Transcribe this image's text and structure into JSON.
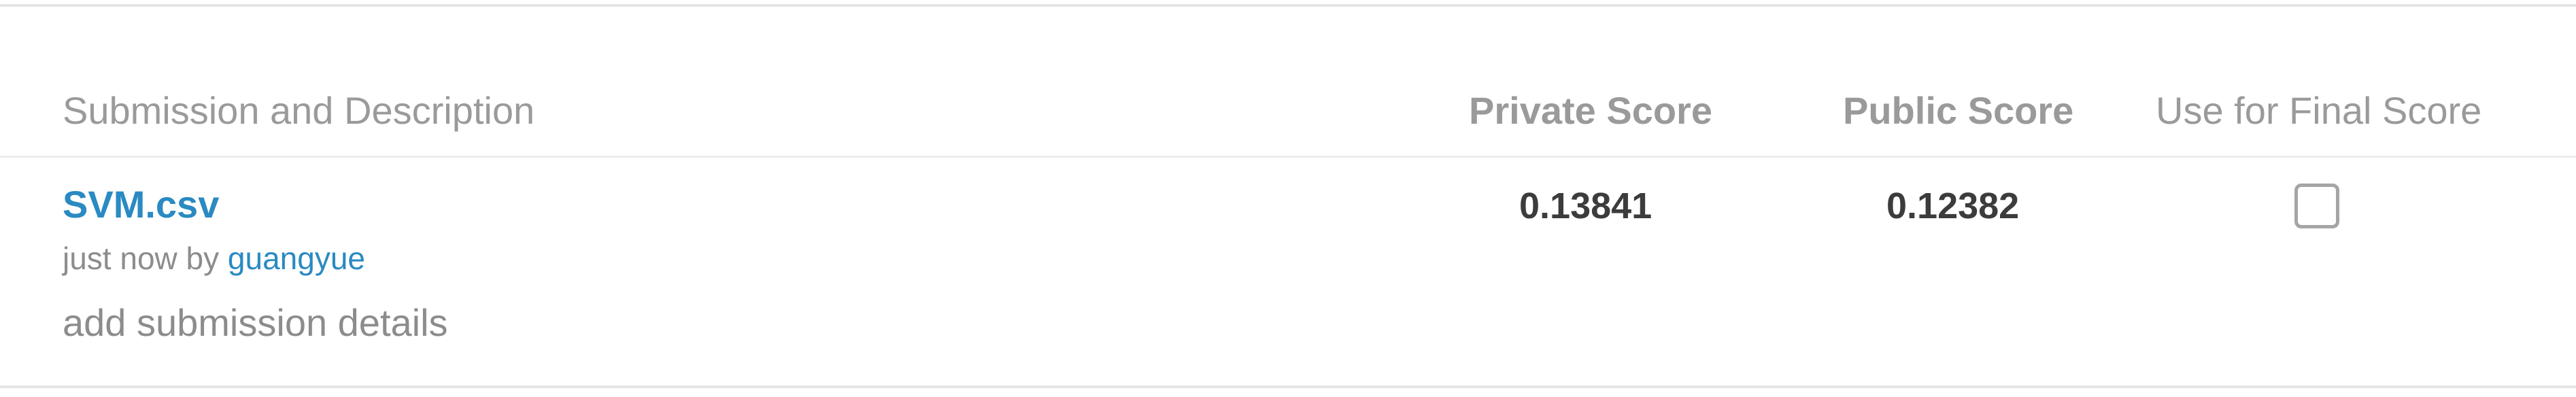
{
  "table": {
    "headers": {
      "submission_and_description": "Submission and Description",
      "private_score": "Private Score",
      "public_score": "Public Score",
      "use_for_final_score": "Use for Final Score"
    },
    "rows": [
      {
        "file_name": "SVM.csv",
        "submitted_prefix": "just now by ",
        "author": "guangyue",
        "details_link": "add submission details",
        "private_score": "0.13841",
        "public_score": "0.12382",
        "use_for_final_score": false
      }
    ]
  }
}
